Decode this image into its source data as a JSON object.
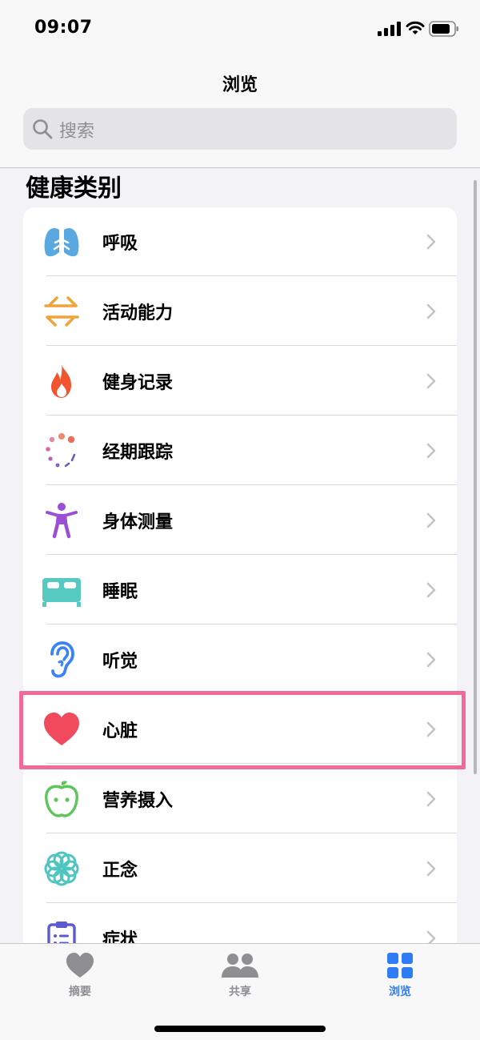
{
  "status_bar": {
    "time": "09:07"
  },
  "header": {
    "title": "浏览",
    "search": {
      "placeholder": "搜索"
    }
  },
  "section_title": "健康类别",
  "categories": [
    {
      "label": "呼吸",
      "icon": "lungs-icon",
      "color": "#5aa8e0"
    },
    {
      "label": "活动能力",
      "icon": "arrows-icon",
      "color": "#f0a23b"
    },
    {
      "label": "健身记录",
      "icon": "flame-icon",
      "color": "#f2542d"
    },
    {
      "label": "经期跟踪",
      "icon": "cycle-icon",
      "color": "#e56b7b"
    },
    {
      "label": "身体测量",
      "icon": "body-figure-icon",
      "color": "#9b4fd6"
    },
    {
      "label": "睡眠",
      "icon": "bed-icon",
      "color": "#56c9c0"
    },
    {
      "label": "听觉",
      "icon": "ear-icon",
      "color": "#3a82f6"
    },
    {
      "label": "心脏",
      "icon": "heart-icon",
      "color": "#f04a5c"
    },
    {
      "label": "营养摄入",
      "icon": "apple-icon",
      "color": "#5cc65a"
    },
    {
      "label": "正念",
      "icon": "mindfulness-icon",
      "color": "#4fc5c0"
    },
    {
      "label": "症状",
      "icon": "clipboard-icon",
      "color": "#5a5ad6"
    }
  ],
  "highlighted_category": "心脏",
  "tab_bar": {
    "tabs": [
      {
        "label": "摘要",
        "icon": "heart-icon",
        "selected": false
      },
      {
        "label": "共享",
        "icon": "people-icon",
        "selected": false
      },
      {
        "label": "浏览",
        "icon": "grid-icon",
        "selected": true
      }
    ],
    "active_color": "#2f7cf6",
    "inactive_color": "#8e8e93"
  }
}
